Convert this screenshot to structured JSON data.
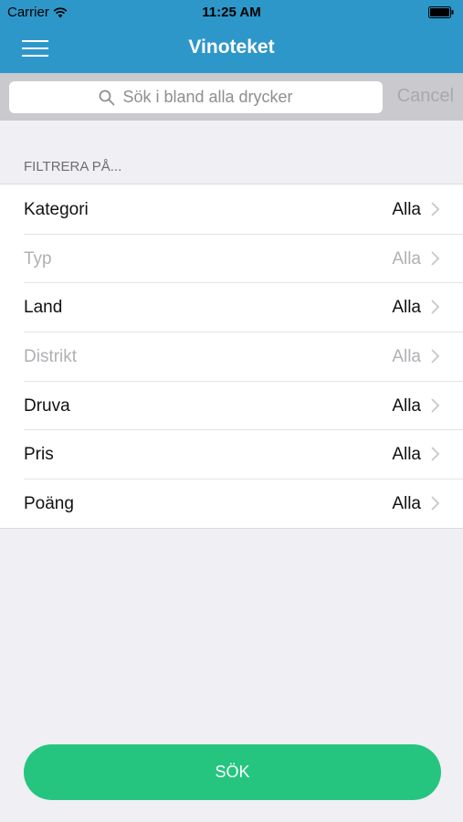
{
  "status_bar": {
    "carrier": "Carrier",
    "time": "11:25 AM",
    "wifi_icon": "wifi-icon",
    "battery_icon": "battery-icon"
  },
  "nav": {
    "title": "Vinoteket",
    "menu_icon": "hamburger-menu-icon",
    "color": "#2e97c9"
  },
  "search": {
    "placeholder": "Sök i bland alla drycker",
    "cancel_label": "Cancel",
    "icon": "search-icon"
  },
  "filter": {
    "header": "FILTRERA PÅ...",
    "rows": [
      {
        "label": "Kategori",
        "value": "Alla",
        "enabled": true
      },
      {
        "label": "Typ",
        "value": "Alla",
        "enabled": false
      },
      {
        "label": "Land",
        "value": "Alla",
        "enabled": true
      },
      {
        "label": "Distrikt",
        "value": "Alla",
        "enabled": false
      },
      {
        "label": "Druva",
        "value": "Alla",
        "enabled": true
      },
      {
        "label": "Pris",
        "value": "Alla",
        "enabled": true
      },
      {
        "label": "Poäng",
        "value": "Alla",
        "enabled": true
      }
    ]
  },
  "submit": {
    "label": "SÖK",
    "color": "#25c580"
  }
}
